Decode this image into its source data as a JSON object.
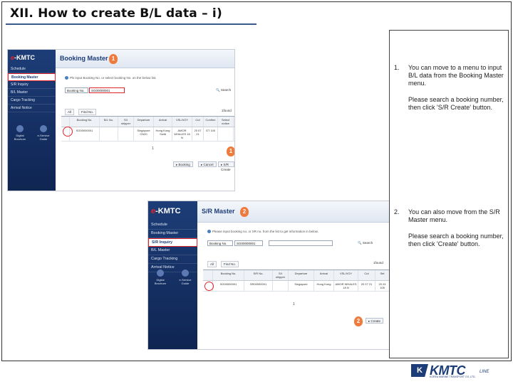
{
  "slide": {
    "title": "XII. How to create B/L data – i)"
  },
  "shot1": {
    "logo_prefix": "e",
    "logo_suffix": "-KMTC",
    "nav": [
      "Schedule",
      "Booking Master",
      "S/R Inquiry",
      "B/L Master",
      "Cargo Tracking",
      "Arrival Notice"
    ],
    "side_icons": [
      "Digital Brochure",
      "e-Service Guide"
    ],
    "page_title": "Booking Master",
    "badge_top": "1",
    "badge_bottom": "1",
    "hint": "Pls input Booking No. or select booking No. on the below list.",
    "search_select": "Booking No.",
    "search_value": "SG00000001",
    "search_button": "Search",
    "tab_all": "All",
    "tab_find": "Find No.",
    "found": "1found",
    "headers": [
      "",
      "Booking No.",
      "B/L No.",
      "S/I shipper",
      "Departure",
      "Arrival",
      "VSL/VOY",
      "Cut",
      "Confirm",
      "Select notice"
    ],
    "row": [
      "",
      "SG00000001",
      "",
      "",
      "Singapore CN20",
      "Hong Kong Switt",
      "AMOR WHALES 18 N",
      "20 07 21",
      "GT 100",
      ""
    ],
    "page": "1",
    "buttons": [
      "Booking",
      "Cancel",
      "S/R Create"
    ]
  },
  "shot2": {
    "logo_prefix": "e",
    "logo_suffix": "-KMTC",
    "nav": [
      "Schedule",
      "Booking Master",
      "S/R Inquiry",
      "B/L Master",
      "Cargo Tracking",
      "Arrival Notice"
    ],
    "side_icons": [
      "Digital Brochure",
      "e-Service Guide"
    ],
    "page_title": "S/R Master",
    "badge_top": "2",
    "badge_bottom": "2",
    "hint": "Please input booking no. or SR no. from the list to get information in below.",
    "search_select": "Booking No.",
    "search_value": "SG00000001",
    "search_button": "Search",
    "tab_all": "All",
    "tab_find": "Find No.",
    "found": "1found",
    "headers": [
      "",
      "Booking No.",
      "S/R No.",
      "S/I shipper",
      "Departure",
      "Arrival",
      "VSL/VOY",
      "Cut",
      "Set"
    ],
    "row": [
      "",
      "SG00000001",
      "SR00000001",
      "",
      "Singapore",
      "Hong Kong",
      "AMOR WHALES 18 N",
      "20 07 21",
      "20 24 105"
    ],
    "page": "1",
    "create_button": "Create"
  },
  "steps": [
    {
      "num": "1.",
      "text": "You can move to a  menu to input B/L data from the Booking Master menu.",
      "sub": "Please search a booking number, then click 'S/R Create' button."
    },
    {
      "num": "2.",
      "text": "You can also move from the S/R Master menu.",
      "sub": "Please search a booking number, then click 'Create' button."
    }
  ],
  "brand": {
    "mark": "K",
    "name": "KMTC",
    "line": "LINE",
    "tagline": "KOREA MARINE TRANSPORT CO.,LTD."
  },
  "colors": {
    "navy": "#1d3d78",
    "accent_red": "#e2242a",
    "badge_orange": "#f07a3c"
  }
}
